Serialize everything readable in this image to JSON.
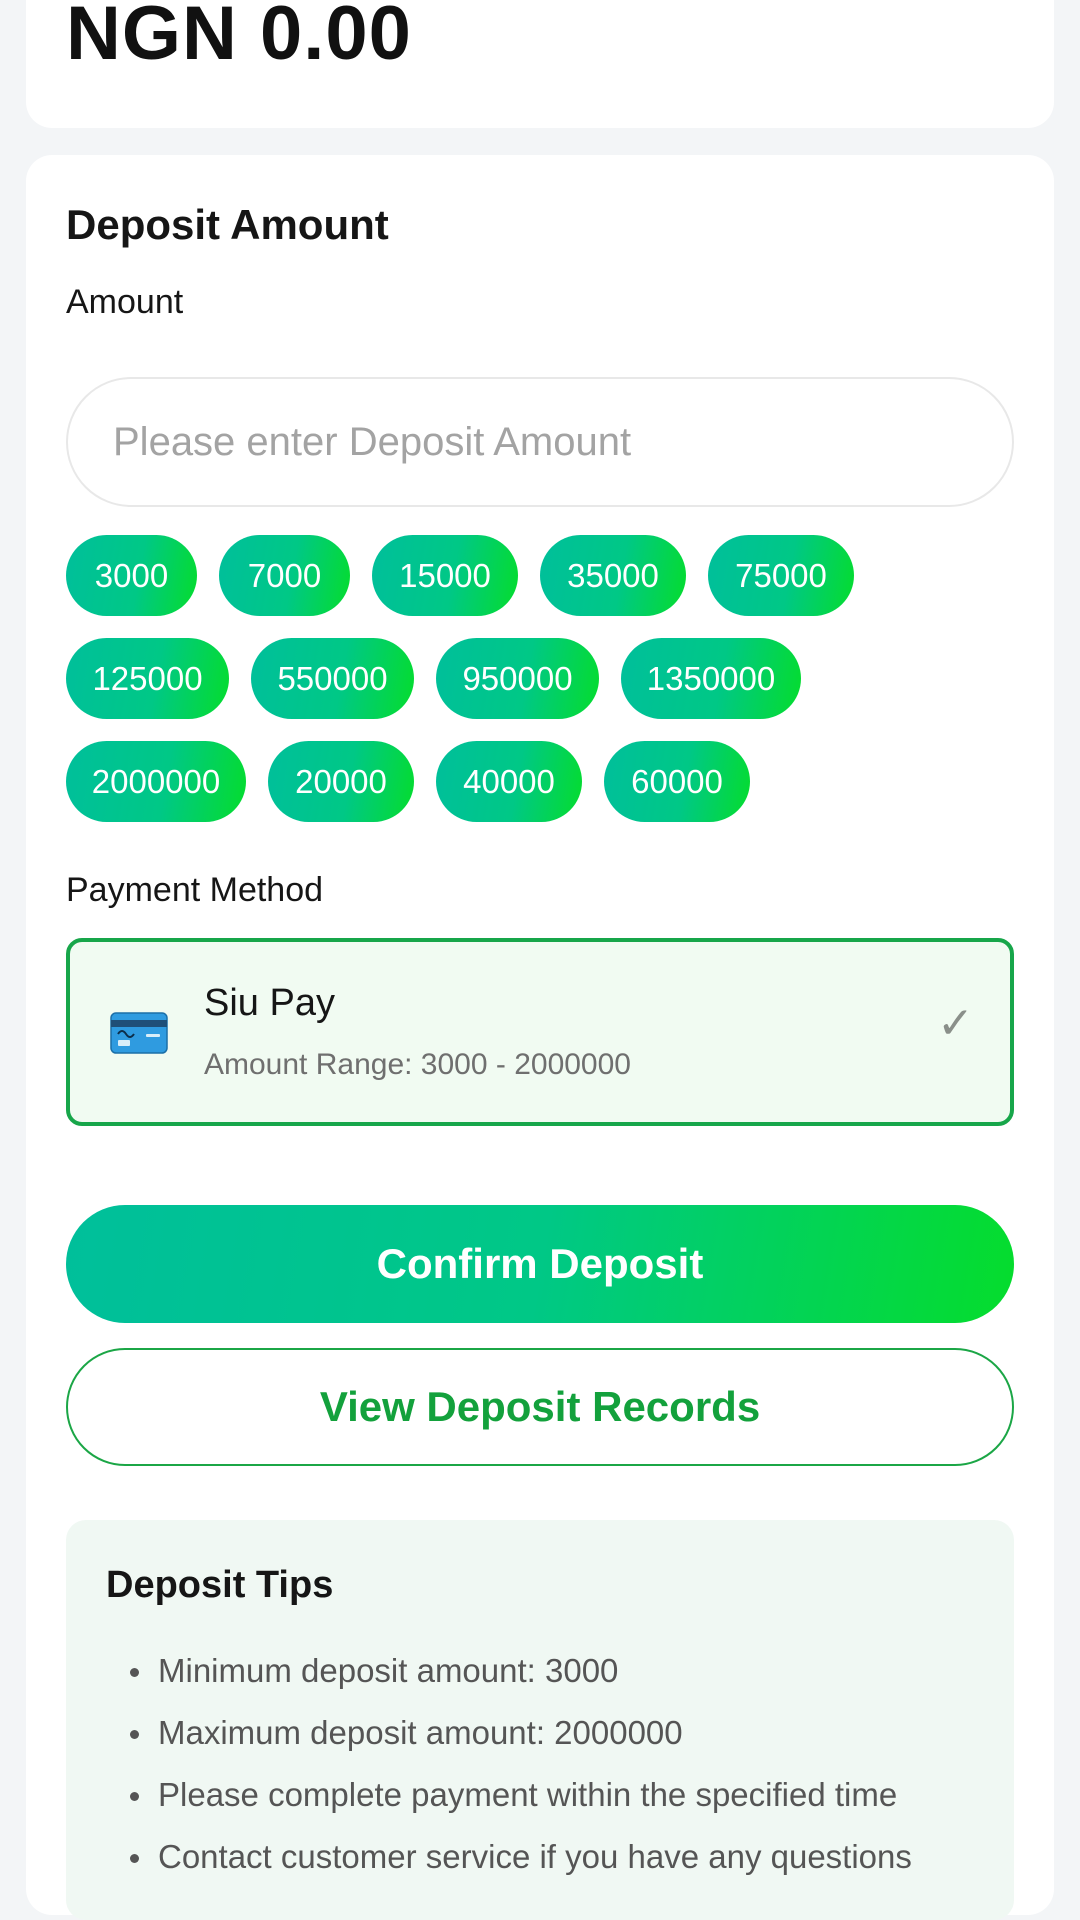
{
  "balance": {
    "value": "NGN 0.00"
  },
  "deposit": {
    "title": "Deposit Amount",
    "amount_label": "Amount",
    "amount_placeholder": "Please enter Deposit Amount",
    "amount_value": "",
    "quick_amounts": [
      [
        "3000",
        "7000",
        "15000",
        "35000",
        "75000"
      ],
      [
        "125000",
        "550000",
        "950000",
        "1350000"
      ],
      [
        "2000000",
        "20000",
        "40000",
        "60000"
      ]
    ],
    "payment_method_label": "Payment Method",
    "payment_method": {
      "name": "Siu Pay",
      "range": "Amount Range: 3000 - 2000000",
      "icon": "credit-card-icon",
      "selected": true,
      "check": "✓"
    },
    "confirm_label": "Confirm Deposit",
    "records_label": "View Deposit Records"
  },
  "tips": {
    "title": "Deposit Tips",
    "items": [
      "Minimum deposit amount: 3000",
      "Maximum deposit amount: 2000000",
      "Please complete payment within the specified time",
      "Contact customer service if you have any questions"
    ]
  },
  "colors": {
    "accent_start": "#00bf9b",
    "accent_end": "#05dd2c",
    "accent_text": "#13a13c",
    "selected_bg": "#f1fbf2"
  }
}
